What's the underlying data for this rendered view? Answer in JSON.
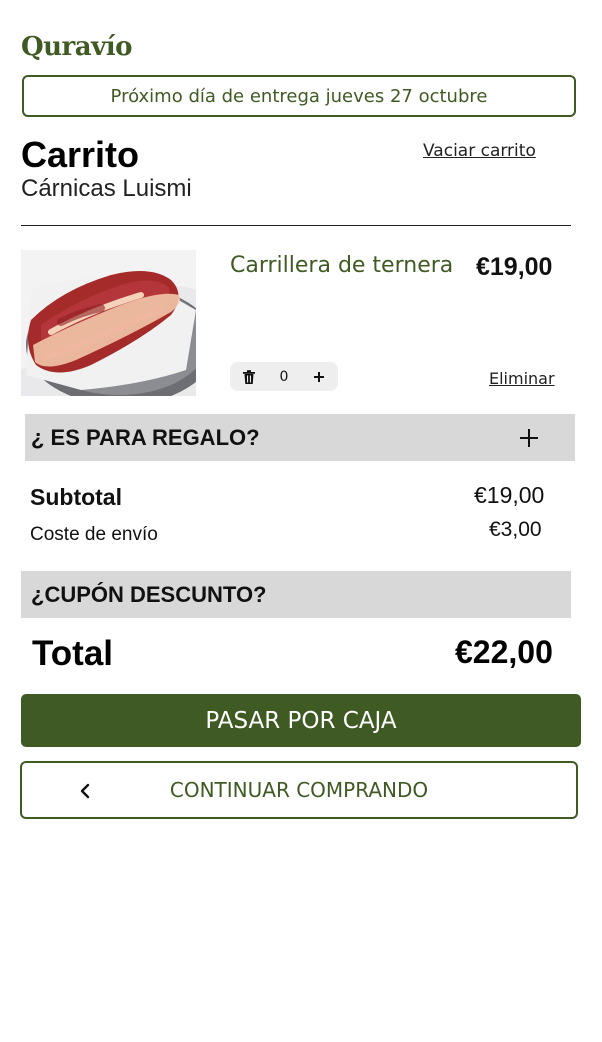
{
  "brand": {
    "logo_text": "Quravío"
  },
  "banner": {
    "text": "Próximo día de entrega jueves 27 octubre"
  },
  "cart": {
    "title": "Carrito",
    "vendor": "Cárnicas Luismi",
    "clear_label": "Vaciar carrito",
    "items": [
      {
        "name": "Carrillera de ternera",
        "price": "€19,00",
        "quantity": "0",
        "remove_label": "Eliminar"
      }
    ]
  },
  "gift": {
    "label": "¿ ES PARA REGALO?"
  },
  "summary": {
    "subtotal_label": "Subtotal",
    "subtotal_value": "€19,00",
    "shipping_label": "Coste de envío",
    "shipping_value": "€3,00"
  },
  "coupon": {
    "label": "¿CUPÓN DESCUNTO?"
  },
  "total": {
    "label": "Total",
    "value": "€22,00"
  },
  "actions": {
    "checkout_label": "PASAR POR CAJA",
    "continue_label": "CONTINUAR COMPRANDO"
  },
  "colors": {
    "brand_green": "#3f5a23",
    "bar_gray": "#d8d8d8",
    "qty_bg": "#eeeeee"
  },
  "icons": {
    "trash": "trash-icon",
    "plus": "plus-icon",
    "chevron": "chevron-left-icon"
  }
}
